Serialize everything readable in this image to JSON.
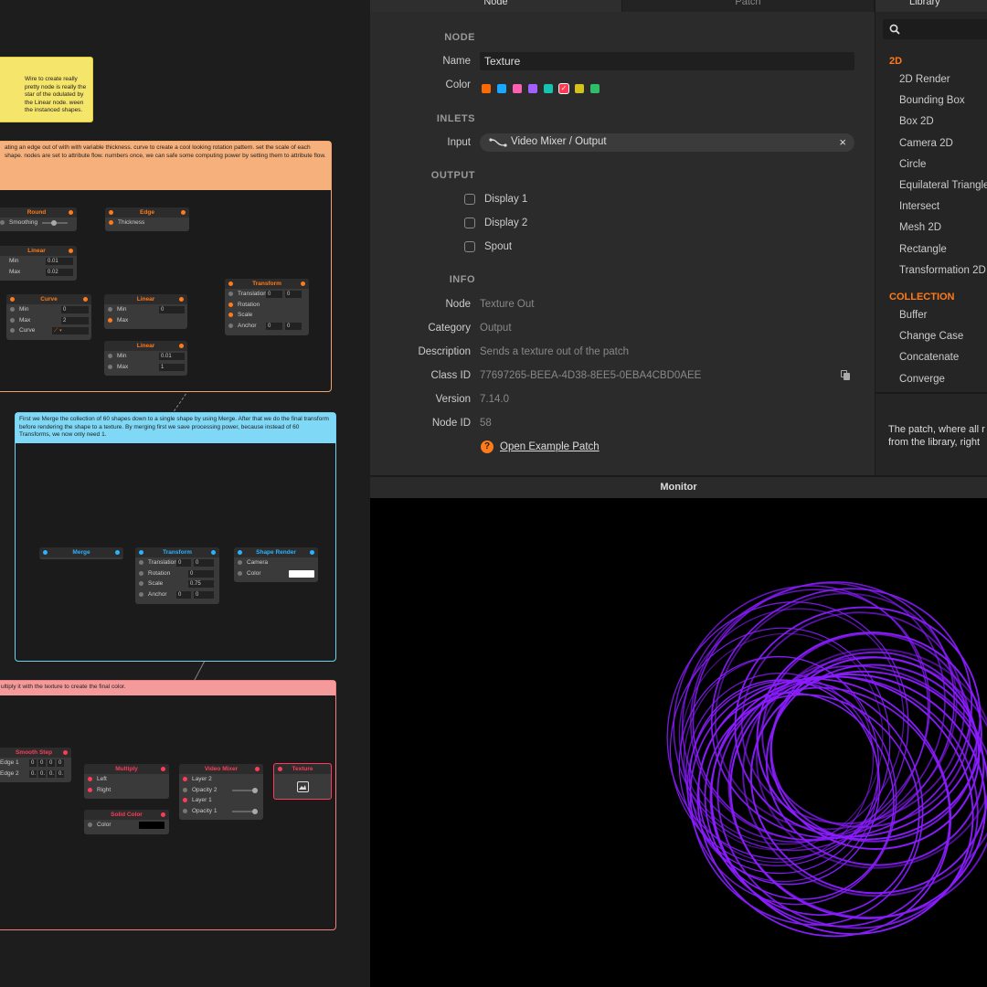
{
  "inspector": {
    "tabs": [
      "Node",
      "Patch"
    ],
    "sections": {
      "node": "NODE",
      "inlets": "INLETS",
      "output": "OUTPUT",
      "info": "INFO"
    },
    "name_label": "Name",
    "name_value": "Texture",
    "color_label": "Color",
    "colors": [
      "#ff6a00",
      "#1aa7ff",
      "#ff5fb0",
      "#a35fff",
      "#14c4b2",
      "#ff3a55",
      "#d6c11a",
      "#2fbf6a"
    ],
    "input_label": "Input",
    "input_value": "Video Mixer / Output",
    "outputs": [
      "Display 1",
      "Display 2",
      "Spout"
    ],
    "info": [
      {
        "label": "Node",
        "value": "Texture Out"
      },
      {
        "label": "Category",
        "value": "Output"
      },
      {
        "label": "Description",
        "value": "Sends a texture out of the patch"
      },
      {
        "label": "Class ID",
        "value": "77697265-BEEA-4D38-8EE5-0EBA4CBD0AEE"
      },
      {
        "label": "Version",
        "value": "7.14.0"
      },
      {
        "label": "Node ID",
        "value": "58"
      }
    ],
    "example_link": "Open Example Patch"
  },
  "library": {
    "tab": "Library",
    "search_placeholder": "",
    "cat_2d": "2D",
    "items_2d": [
      "2D Render",
      "Bounding Box",
      "Box 2D",
      "Camera 2D",
      "Circle",
      "Equilateral Triangle",
      "Intersect",
      "Mesh 2D",
      "Rectangle",
      "Transformation 2D"
    ],
    "cat_collection": "COLLECTION",
    "items_collection": [
      "Buffer",
      "Change Case",
      "Concatenate",
      "Converge"
    ],
    "description": "The patch, where all r from the library, right"
  },
  "monitor": {
    "title": "Monitor",
    "ring_color": "#8a1cff"
  },
  "canvas": {
    "notes": [
      "Wire to create really pretty node is really the star of the odulated by the Linear node. ween the instanced shapes.",
      "ating an edge out of with with variable thickness. curve to create a cool looking rotation pattern. set the scale of each shape. nodes are set to attribute flow. numbers once, we can safe some computing power by setting them to attribute flow.",
      "First we Merge the collection of 60 shapes down to a single shape by using Merge. After that we do the final transform before rendering the shape to a texture. By merging first we save processing power, because instead of 60 Transforms, we now only need 1.",
      "ultiply it with the texture to create the final color."
    ],
    "n_round": "Round",
    "n_round_smoothing": "Smoothing",
    "n_edge": "Edge",
    "n_edge_thickness": "Thickness",
    "n_linear": "Linear",
    "min": "Min",
    "max": "Max",
    "n_linear1_min": "0.01",
    "n_linear1_max": "0.02",
    "n_curve": "Curve",
    "n_curve_min": "0",
    "n_curve_max": "2",
    "n_curve_curve": "Curve",
    "n_linear2_min": "0",
    "n_linear3_min": "0.01",
    "n_linear3_max": "1",
    "n_transform": "Transform",
    "translation": "Translation",
    "rotation": "Rotation",
    "scale": "Scale",
    "anchor": "Anchor",
    "zero": "0",
    "n_transform2_scale": "0.75",
    "n_merge": "Merge",
    "n_shape_render": "Shape Render",
    "camera": "Camera",
    "color": "Color",
    "n_smooth_step": "Smooth Step",
    "edge1": "Edge 1",
    "edge2": "Edge 2",
    "e2val": "0.",
    "n_multiply": "Multiply",
    "left": "Left",
    "right": "Right",
    "n_video_mixer": "Video Mixer",
    "layer2": "Layer 2",
    "opacity2": "Opacity 2",
    "layer1": "Layer 1",
    "opacity1": "Opacity 1",
    "n_texture": "Texture",
    "n_solid_color": "Solid Color"
  }
}
